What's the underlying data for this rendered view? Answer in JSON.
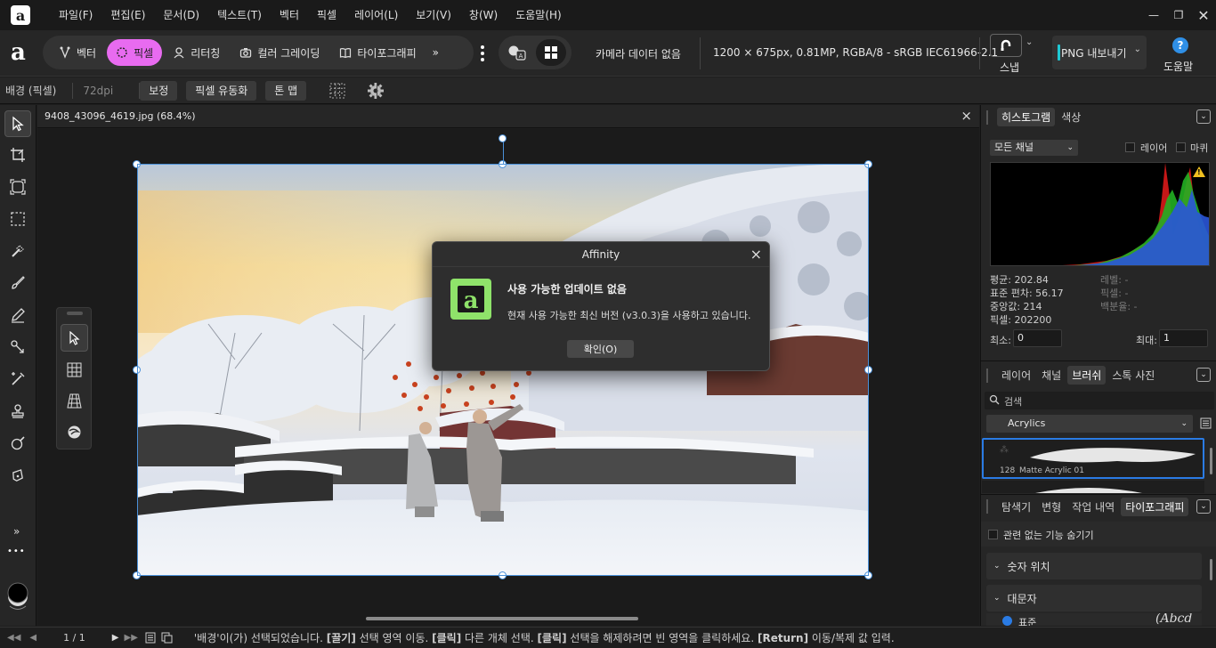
{
  "menu": {
    "items": [
      "파일(F)",
      "편집(E)",
      "문서(D)",
      "텍스트(T)",
      "벡터",
      "픽셀",
      "레이어(L)",
      "보기(V)",
      "창(W)",
      "도움말(H)"
    ]
  },
  "toolbar": {
    "personas": [
      "벡터",
      "픽셀",
      "리터칭",
      "컬러 그레이딩",
      "타이포그래피"
    ],
    "more": "»",
    "camera_info": "카메라 데이터 없음",
    "doc_info": "1200 × 675px, 0.81MP, RGBA/8 - sRGB IEC61966-2.1",
    "snap_label": "스냅",
    "export_label": "PNG 내보내기",
    "help_label": "도움말",
    "accent": "#e86bf0"
  },
  "context": {
    "layer": "배경 (픽셀)",
    "dpi": "72dpi",
    "buttons": [
      "보정",
      "픽셀 유동화",
      "톤 맵"
    ]
  },
  "document": {
    "tab_title": "9408_43096_4619.jpg (68.4%)",
    "close": "×"
  },
  "dialog": {
    "title": "Affinity",
    "heading": "사용 가능한 업데이트 없음",
    "message": "현재 사용 가능한 최신 버전 (v3.0.3)을 사용하고 있습니다.",
    "ok": "확인(O)",
    "close": "×"
  },
  "histogram": {
    "tabs": [
      "히스토그램",
      "색상"
    ],
    "channel": "모든 채널",
    "layer_check": "레이어",
    "marquee_check": "마퀴",
    "stats_left": [
      "평균: 202.84",
      "표준 편차: 56.17",
      "중앙값: 214",
      "픽셀: 202200"
    ],
    "stats_right": [
      "레벨: -",
      "픽셀: -",
      "백분율: -"
    ],
    "min_label": "최소:",
    "min_value": "0",
    "max_label": "최대:",
    "max_value": "1",
    "colors": {
      "red": "#d01818",
      "green": "#22b022",
      "blue": "#2a55d8"
    }
  },
  "brushes": {
    "tabs": [
      "레이어",
      "채널",
      "브러쉬",
      "스톡 사진"
    ],
    "search_placeholder": "검색",
    "category": "Acrylics",
    "selected_size": "128",
    "selected_name": "Matte Acrylic 01"
  },
  "typography": {
    "tabs": [
      "탐색기",
      "변형",
      "작업 내역",
      "타이포그래피"
    ],
    "hide_unrelated": "관련 없는 기능 숨기기",
    "sections": [
      "숫자 위치",
      "대문자"
    ],
    "option_partial": "표준",
    "preview_text": "(Abcd"
  },
  "status": {
    "page": "1 / 1",
    "message_parts": [
      "'배경'이(가) 선택되었습니다. ",
      "[끌기]",
      " 선택 영역 이동. ",
      "[클릭]",
      " 다른 개체 선택. ",
      "[클릭]",
      " 선택을 해제하려면 빈 영역을 클릭하세요. ",
      "[Return]",
      " 이동/복제 값 입력."
    ]
  },
  "left_tools": {
    "more": "»",
    "dots": "•••"
  }
}
